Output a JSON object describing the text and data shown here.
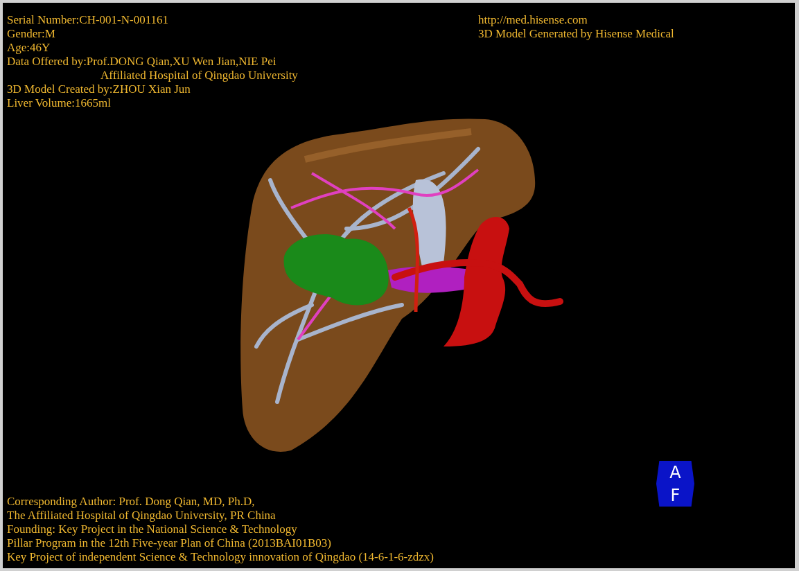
{
  "header_left": [
    {
      "text": "Serial Number:CH-001-N-001161",
      "kind": "line"
    },
    {
      "text": "Gender:M",
      "kind": "line"
    },
    {
      "text": "Age:46Y",
      "kind": "line"
    },
    {
      "text": "Data Offered by:Prof.DONG Qian,XU Wen Jian,NIE Pei",
      "kind": "line"
    },
    {
      "text": "Affiliated Hospital of Qingdao University",
      "kind": "continuation"
    },
    {
      "text": "3D Model Created by:ZHOU Xian Jun",
      "kind": "line"
    },
    {
      "text": "Liver Volume:1665ml",
      "kind": "line"
    }
  ],
  "header_right": [
    "http://med.hisense.com",
    "3D Model Generated by Hisense Medical"
  ],
  "footer": [
    "Corresponding Author: Prof. Dong Qian, MD, Ph.D,",
    "The Affiliated Hospital of Qingdao University, PR China",
    "Founding: Key Project in the National Science & Technology",
    "Pillar Program in the 12th Five-year Plan of China (2013BAI01B03)",
    "Key Project of independent Science & Technology innovation of Qingdao (14-6-1-6-zdzx)"
  ],
  "orientation_cube": {
    "top": "A",
    "bottom": "F"
  }
}
